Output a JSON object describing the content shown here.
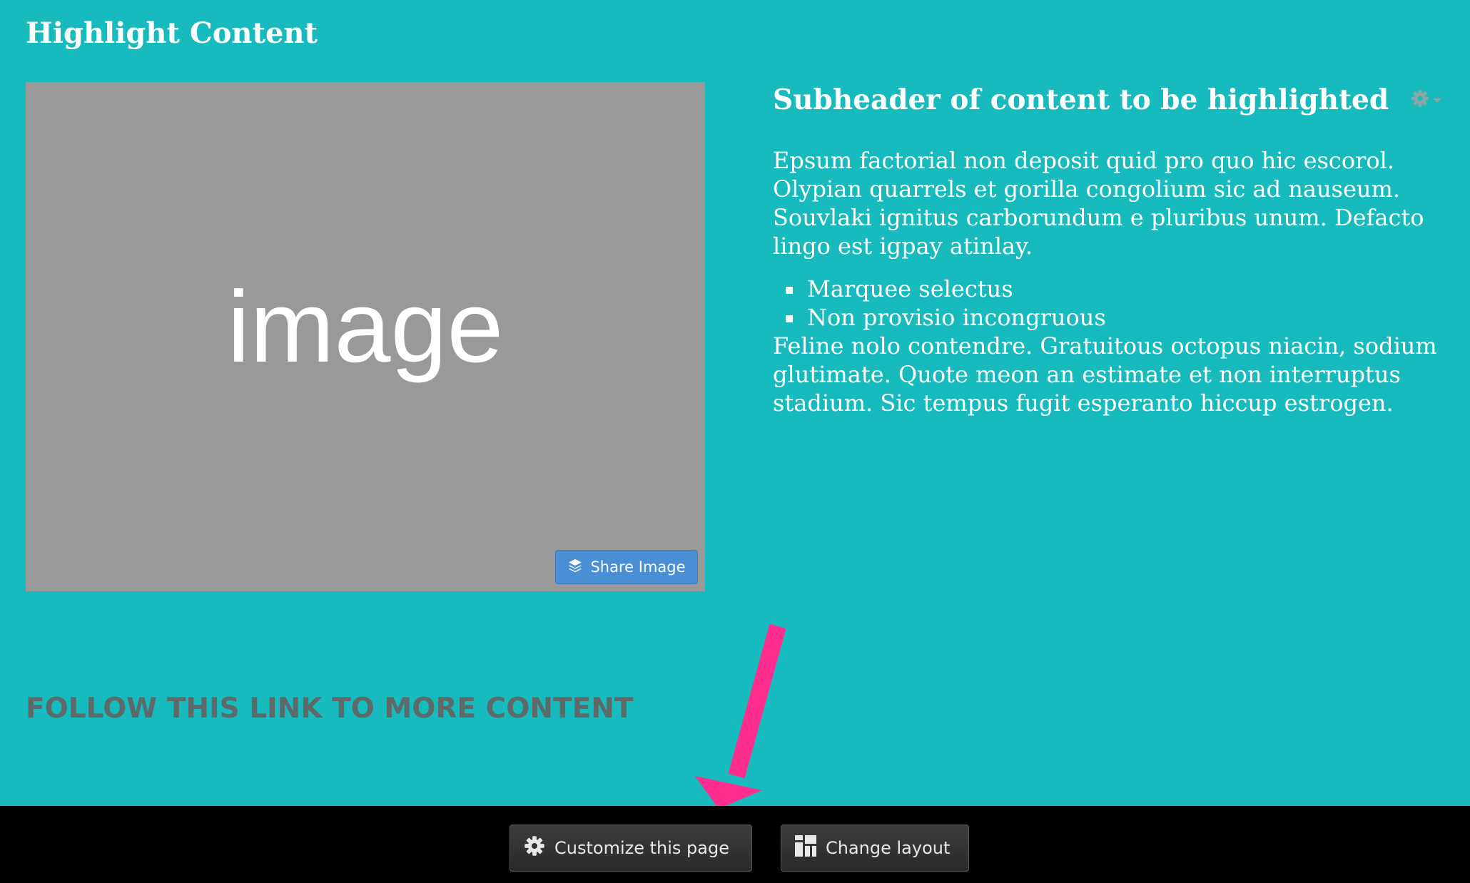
{
  "page": {
    "title": "Highlight Content"
  },
  "image": {
    "placeholder_text": "image",
    "share_label": "Share Image"
  },
  "content": {
    "subheader": "Subheader of content to be highlighted",
    "paragraph1": "Epsum factorial non deposit quid pro quo hic escorol. Olypian quarrels et gorilla congolium sic ad nauseum. Souvlaki ignitus carborundum e pluribus unum. Defacto lingo est igpay atinlay.",
    "list_items": [
      "Marquee selectus",
      "Non provisio incongruous"
    ],
    "paragraph2": "Feline nolo contendre. Gratuitous octopus niacin, sodium glutimate. Quote meon an estimate et non interruptus stadium. Sic tempus fugit esperanto hiccup estrogen."
  },
  "follow_link": "FOLLOW THIS LINK TO MORE CONTENT",
  "toolbar": {
    "customize_label": "Customize this page",
    "layout_label": "Change layout"
  },
  "colors": {
    "background": "#17babd",
    "image_placeholder": "#999999",
    "share_button": "#4a8fd4",
    "link_text": "#5e6a6a",
    "annotation_arrow": "#ff2e8e",
    "toolbar": "#000000"
  },
  "icons": {
    "share": "layers-icon",
    "settings": "gear-icon",
    "menu": "caret-down-icon",
    "layout": "layout-grid-icon"
  }
}
